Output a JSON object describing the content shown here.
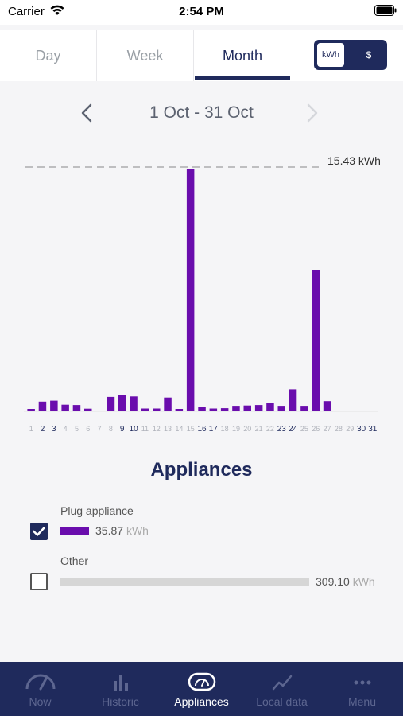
{
  "status": {
    "carrier": "Carrier",
    "time": "2:54 PM"
  },
  "tabs": {
    "day": "Day",
    "week": "Week",
    "month": "Month",
    "active": "month"
  },
  "unit_toggle": {
    "kwh": "kWh",
    "dollar": "$",
    "selected": "kWh"
  },
  "date_range": "1 Oct - 31 Oct",
  "chart_data": {
    "type": "bar",
    "categories": [
      "1",
      "2",
      "3",
      "4",
      "5",
      "6",
      "7",
      "8",
      "9",
      "10",
      "11",
      "12",
      "13",
      "14",
      "15",
      "16",
      "17",
      "18",
      "19",
      "20",
      "21",
      "22",
      "23",
      "24",
      "25",
      "26",
      "27",
      "28",
      "29",
      "30",
      "31"
    ],
    "values": [
      0.12,
      0.62,
      0.68,
      0.42,
      0.4,
      0.17,
      0,
      0.92,
      1.05,
      0.95,
      0.18,
      0.18,
      0.88,
      0.15,
      15.43,
      0.27,
      0.18,
      0.2,
      0.35,
      0.37,
      0.4,
      0.55,
      0.35,
      1.4,
      0.35,
      9.03,
      0.65,
      0,
      0,
      0,
      0
    ],
    "highlighted_ticks": [
      "2",
      "3",
      "9",
      "10",
      "16",
      "17",
      "23",
      "24",
      "30",
      "31"
    ],
    "max_line_label": "15.43 kWh",
    "max_value": 15.43,
    "bar_color": "#6a0dad"
  },
  "appliances": {
    "title": "Appliances",
    "items": [
      {
        "label": "Plug appliance",
        "value": "35.87",
        "unit": "kWh",
        "checked": true
      },
      {
        "label": "Other",
        "value": "309.10",
        "unit": "kWh",
        "checked": false
      }
    ]
  },
  "bottom_nav": {
    "items": [
      {
        "label": "Now",
        "icon": "gauge-icon"
      },
      {
        "label": "Historic",
        "icon": "bar-chart-icon"
      },
      {
        "label": "Appliances",
        "icon": "appliance-meter-icon"
      },
      {
        "label": "Local data",
        "icon": "line-chart-icon"
      },
      {
        "label": "Menu",
        "icon": "more-icon"
      }
    ],
    "active": "Appliances"
  },
  "colors": {
    "navy": "#1f2a5c",
    "purple": "#6a0dad",
    "inactive_nav": "#5d6690"
  }
}
